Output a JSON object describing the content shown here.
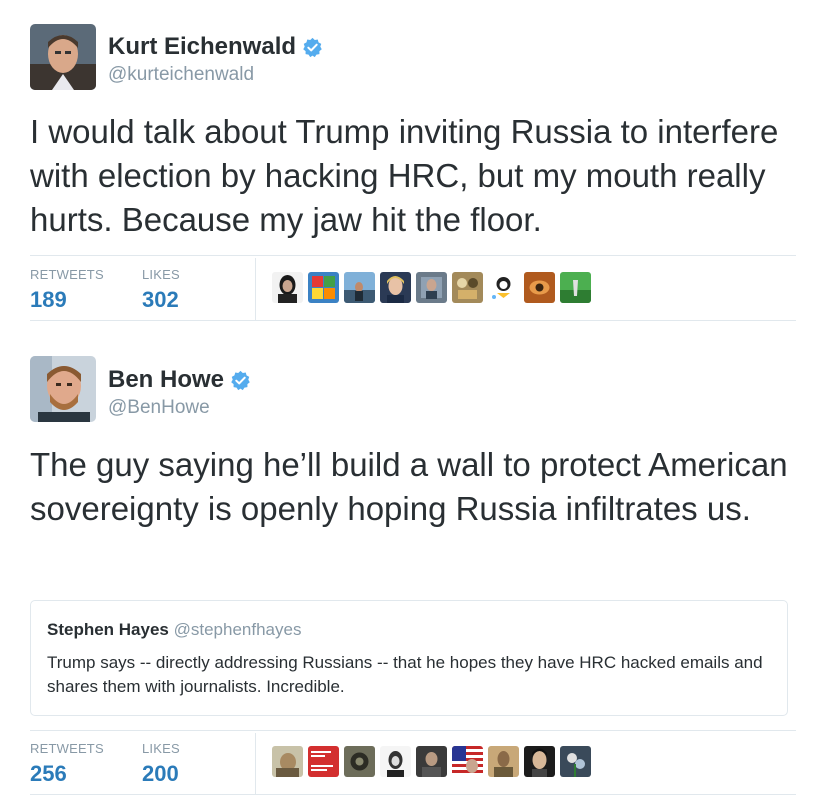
{
  "tweets": [
    {
      "author": {
        "name": "Kurt Eichenwald",
        "handle": "@kurteichenwald",
        "verified": true
      },
      "text": "I would talk about Trump inviting Russia to interfere with election by hacking HRC, but my mouth really hurts. Because my jaw hit the floor.",
      "stats": {
        "retweets_label": "RETWEETS",
        "retweets": "189",
        "likes_label": "LIKES",
        "likes": "302"
      }
    },
    {
      "author": {
        "name": "Ben Howe",
        "handle": "@BenHowe",
        "verified": true
      },
      "text": "The guy saying he’ll build a wall to protect American sovereignty is openly hoping Russia infiltrates us.",
      "quoted": {
        "name": "Stephen Hayes",
        "handle": "@stephenfhayes",
        "text": "Trump says -- directly addressing Russians -- that he hopes they have HRC hacked emails and shares them with journalists. Incredible."
      },
      "stats": {
        "retweets_label": "RETWEETS",
        "retweets": "256",
        "likes_label": "LIKES",
        "likes": "200"
      }
    }
  ],
  "colors": {
    "verified": "#55acee",
    "stat_value": "#2b7bb9",
    "muted": "#8899a6",
    "border": "#e1e8ed"
  },
  "icons": {
    "verified": "verified-badge-icon"
  }
}
